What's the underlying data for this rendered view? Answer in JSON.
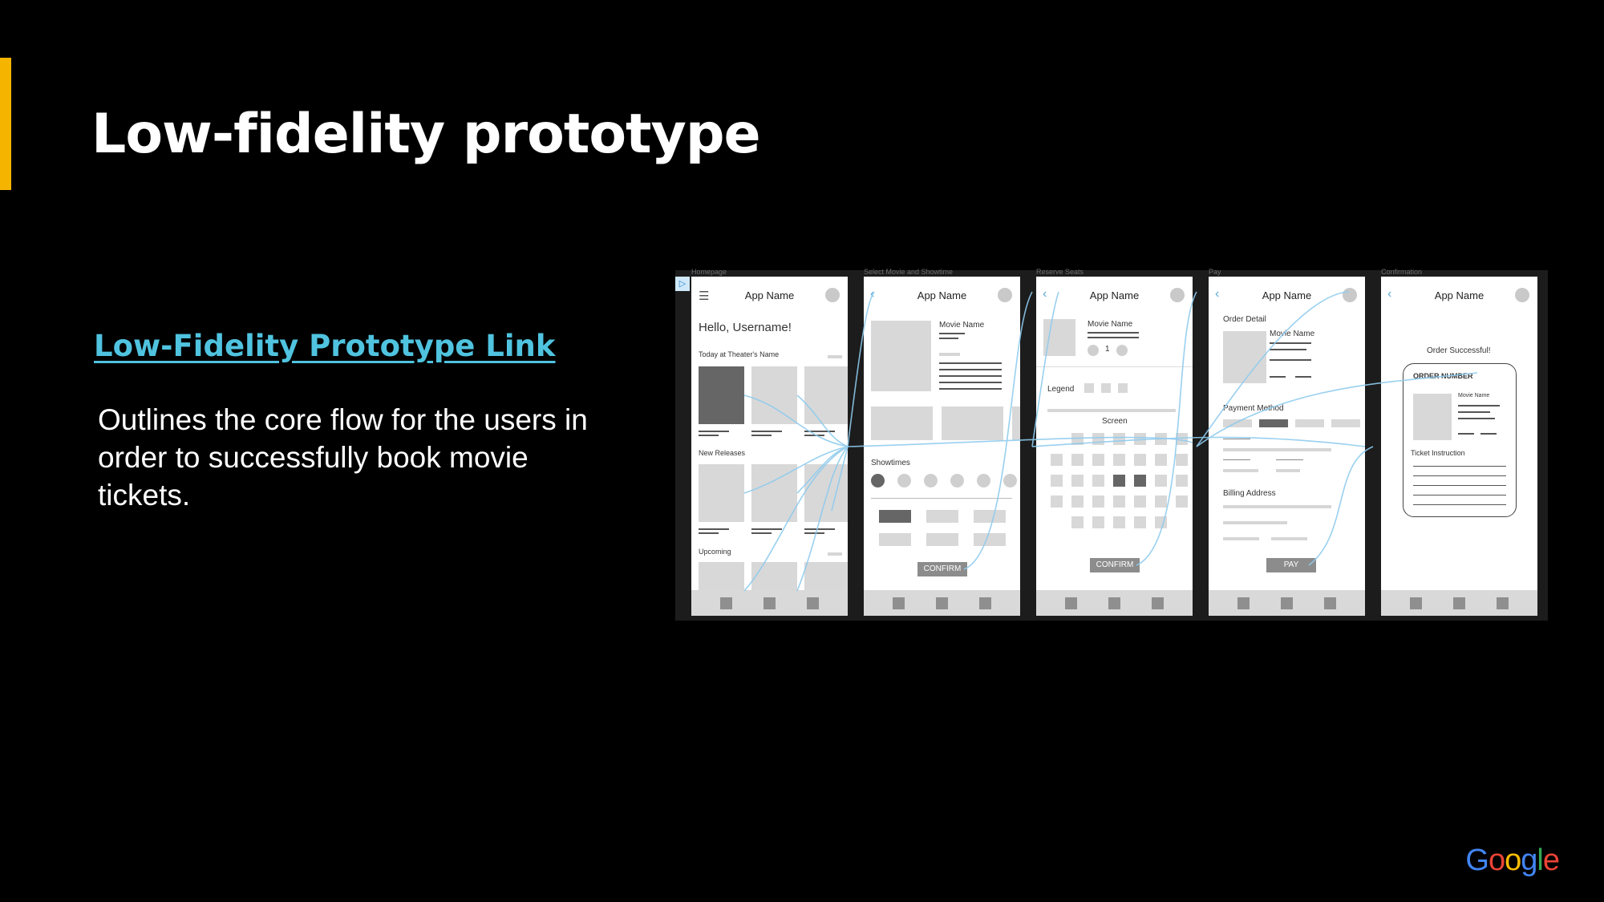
{
  "slide": {
    "title": "Low-fidelity prototype",
    "link_text": "Low-Fidelity Prototype Link",
    "description": "Outlines the core flow for the users in order to successfully book movie tickets.",
    "logo": [
      "G",
      "o",
      "o",
      "g",
      "l",
      "e"
    ]
  },
  "colors": {
    "accent": "#f5b400",
    "link": "#4fc3df",
    "flow_line": "#8ecbee",
    "google": [
      "#4285F4",
      "#EA4335",
      "#FBBC05",
      "#4285F4",
      "#34A853",
      "#EA4335"
    ]
  },
  "wireframes": {
    "frame_labels": [
      "Homepage",
      "Select Movie and Showtime",
      "Reserve Seats",
      "Pay",
      "Confirmation"
    ],
    "app_name": "App Name",
    "home": {
      "greeting": "Hello, Username!",
      "section_today": "Today at Theater's Name",
      "section_new": "New Releases",
      "section_upcoming": "Upcoming"
    },
    "select": {
      "movie_name": "Movie Name",
      "showtimes": "Showtimes",
      "confirm": "CONFIRM"
    },
    "seats": {
      "movie_name": "Movie Name",
      "count": "1",
      "legend": "Legend",
      "screen": "Screen",
      "confirm": "CONFIRM"
    },
    "pay": {
      "order_detail": "Order Detail",
      "movie_name": "Movie Name",
      "payment_method": "Payment Method",
      "billing_address": "Billing Address",
      "pay": "PAY"
    },
    "confirmation": {
      "success": "Order Successful!",
      "order_number": "ORDER NUMBER",
      "movie_name": "Movie Name",
      "ticket_instruction": "Ticket Instruction"
    }
  }
}
